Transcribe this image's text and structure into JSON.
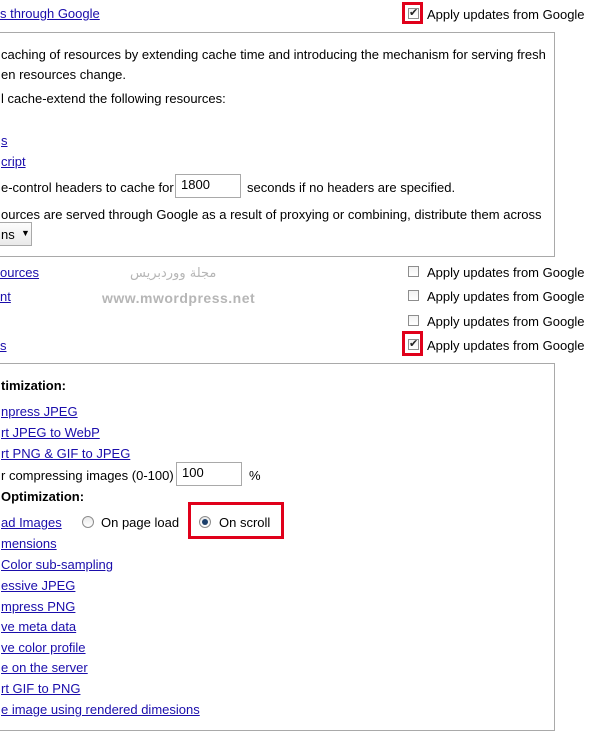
{
  "top": {
    "link": "s through Google",
    "update": {
      "label": "Apply updates from Google",
      "checked": true
    }
  },
  "cache_box": {
    "desc_line1": "caching of resources by extending cache time and introducing the mechanism for serving fresh",
    "desc_line2": "en resources change.",
    "extend_label": "l cache-extend the following resources:",
    "link1": "s",
    "link2": "cript",
    "cache_control_before": "e-control headers to cache for",
    "cache_seconds_value": "1800",
    "cache_control_after": "seconds if no headers are specified.",
    "distribute_text": "ources are served through Google as a result of proxying or combining, distribute them across",
    "select_value": "ns"
  },
  "resource_rows": [
    {
      "link": "ources",
      "update_label": "Apply updates from Google",
      "checked": false
    },
    {
      "link": "nt",
      "update_label": "Apply updates from Google",
      "checked": false
    },
    {
      "link": "",
      "update_label": "Apply updates from Google",
      "checked": false
    },
    {
      "link": "s",
      "update_label": "Apply updates from Google",
      "checked": true
    }
  ],
  "watermark": {
    "arabic": "مجلة ووردبريس",
    "url": "www.mwordpress.net"
  },
  "image_box": {
    "heading1": "timization:",
    "links1": [
      "npress JPEG",
      "rt JPEG to WebP",
      "rt PNG & GIF to JPEG"
    ],
    "quality_before": "r compressing images (0-100)",
    "quality_value": "100",
    "quality_unit": "%",
    "heading2": "Optimization:",
    "lazy_link": "ad Images",
    "radio_page_load": "On page load",
    "radio_on_scroll": "On scroll",
    "radio_selected": "On scroll",
    "links2": [
      "mensions",
      "Color sub-sampling",
      "essive JPEG",
      "mpress PNG",
      "ve meta data",
      "ve color profile",
      "e on the server",
      "rt GIF to PNG",
      "e image using rendered dimesions"
    ]
  },
  "colors": {
    "link": "#1a0dab",
    "highlight": "#e0001a",
    "border": "#a9a9a9"
  }
}
